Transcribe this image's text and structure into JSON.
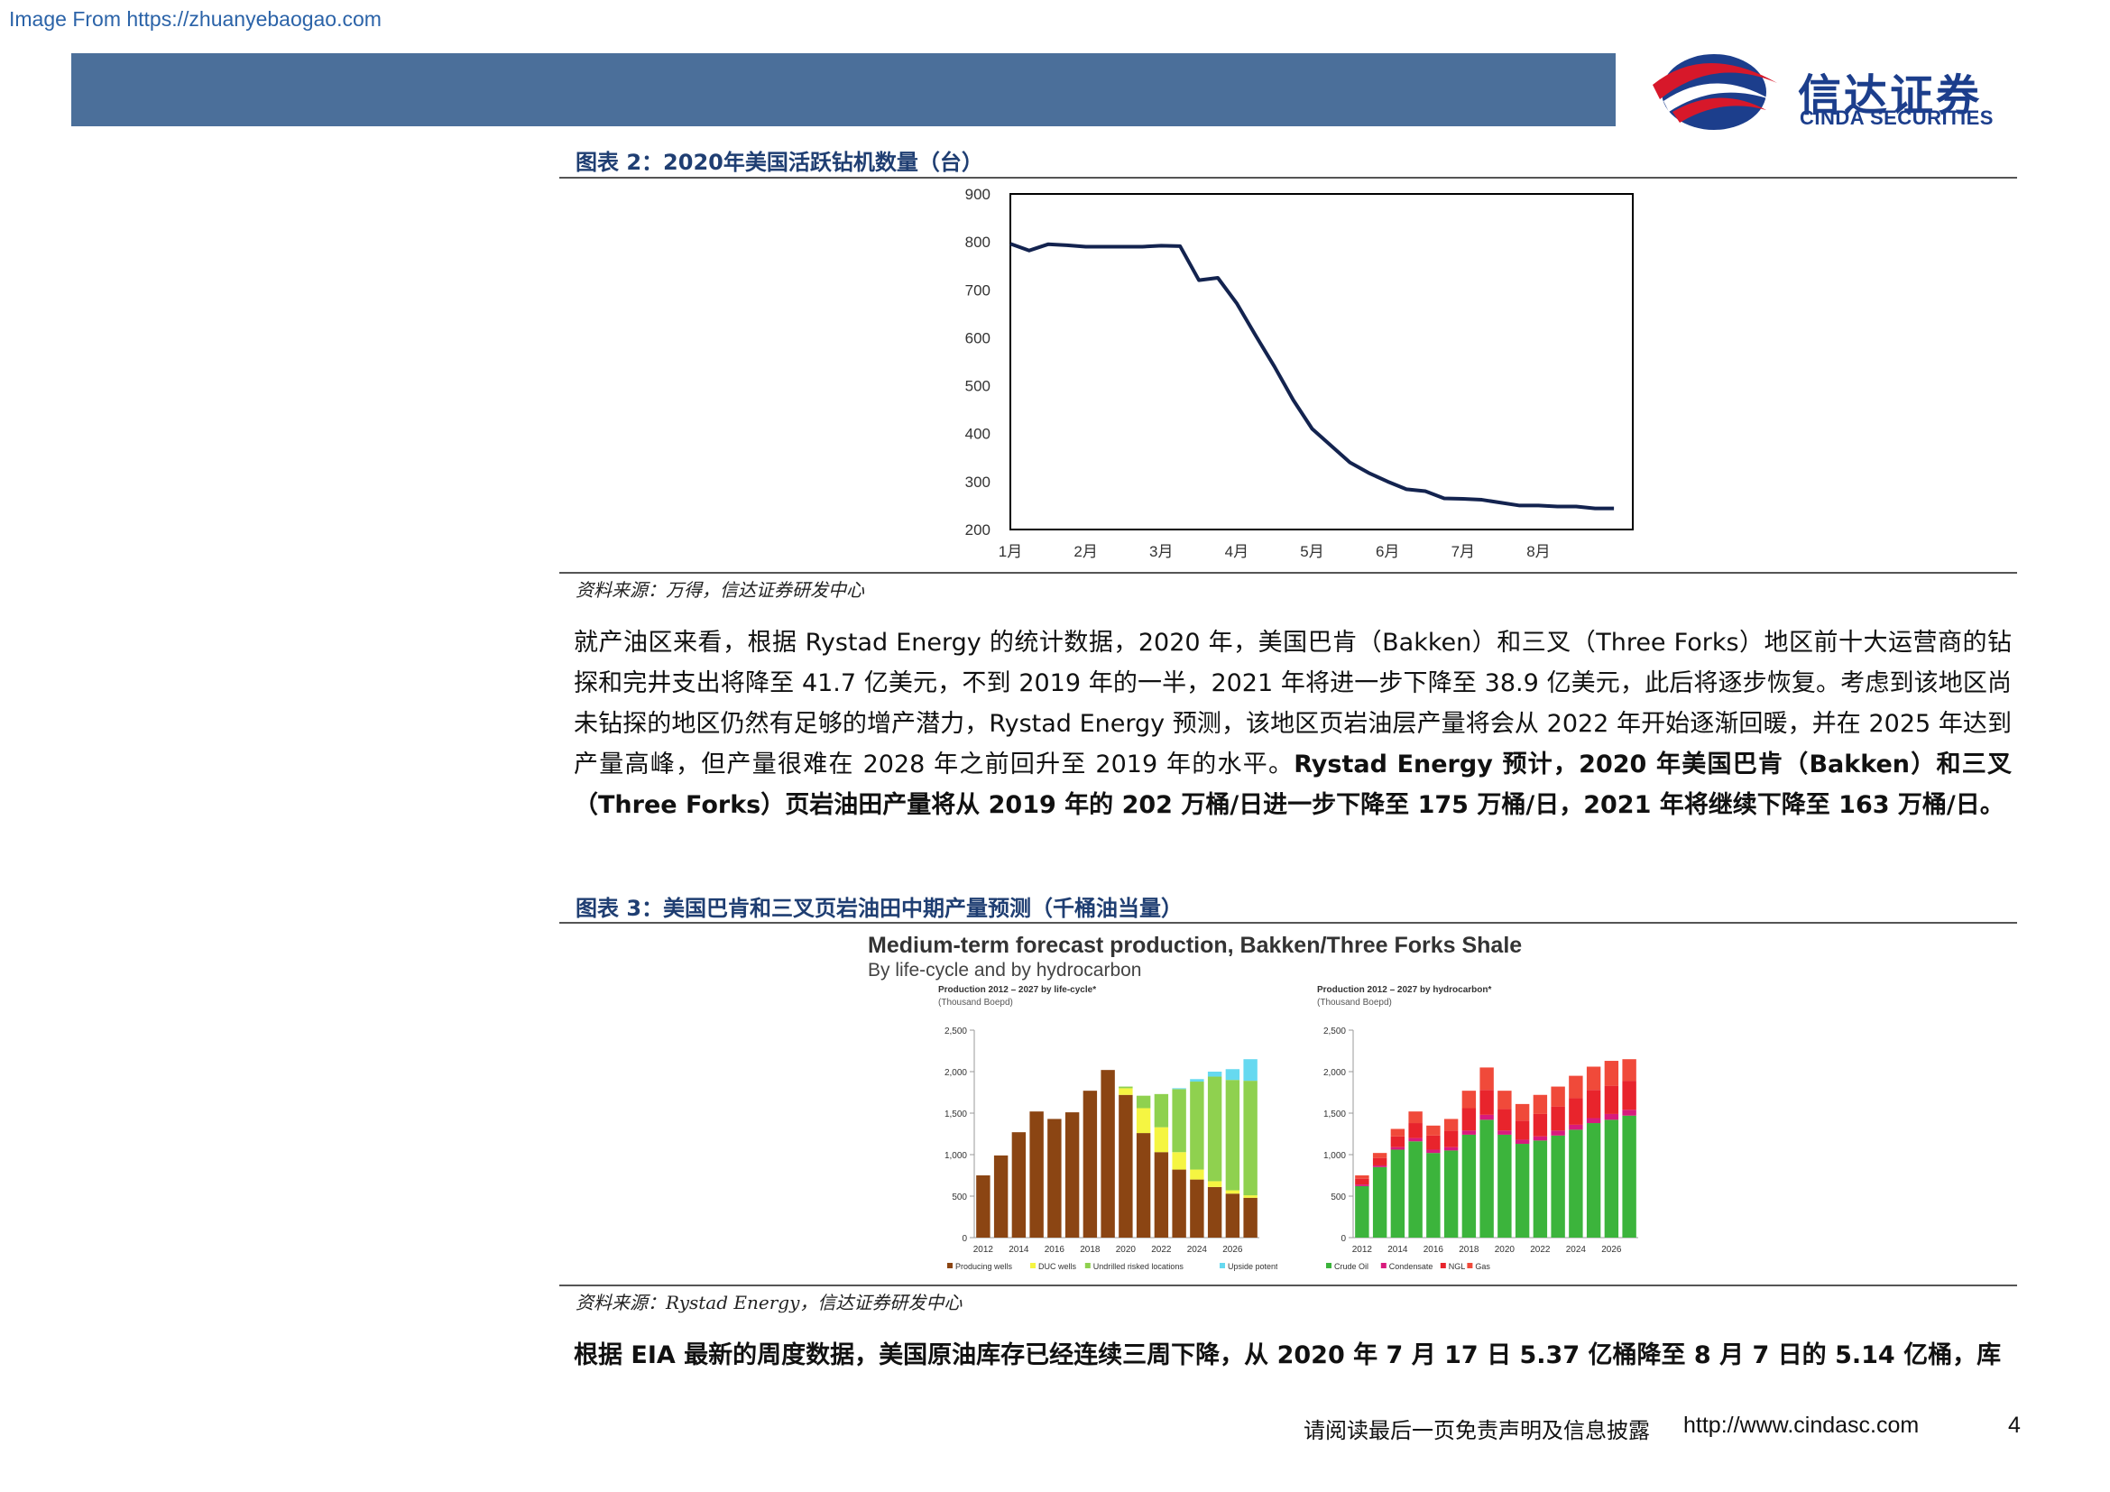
{
  "watermark": "Image From https://zhuanyebaogao.com",
  "logo": {
    "cn": "信达证券",
    "en": "CINDA SECURITIES"
  },
  "figure2": {
    "title": "图表 2：2020年美国活跃钻机数量（台）",
    "source": "资料来源：万得，信达证券研发中心"
  },
  "paragraph1": {
    "text": "就产油区来看，根据 Rystad Energy 的统计数据，2020 年，美国巴肯（Bakken）和三叉（Three Forks）地区前十大运营商的钻探和完井支出将降至 41.7 亿美元，不到 2019 年的一半，2021 年将进一步下降至 38.9 亿美元，此后将逐步恢复。考虑到该地区尚未钻探的地区仍然有足够的增产潜力，Rystad Energy 预测，该地区页岩油层产量将会从 2022 年开始逐渐回暖，并在 2025 年达到产量高峰，但产量很难在 2028 年之前回升至 2019 年的水平。",
    "bold": "Rystad Energy 预计，2020 年美国巴肯（Bakken）和三叉（Three Forks）页岩油田产量将从 2019 年的 202 万桶/日进一步下降至 175 万桶/日，2021 年将继续下降至 163 万桶/日。"
  },
  "figure3": {
    "title": "图表 3：美国巴肯和三叉页岩油田中期产量预测（千桶油当量）",
    "source": "资料来源：Rystad Energy，信达证券研发中心",
    "inner_title": "Medium-term forecast production, Bakken/Three Forks Shale",
    "inner_subtitle": "By life-cycle and by hydrocarbon"
  },
  "paragraph2": {
    "bold": "根据 EIA 最新的周度数据，美国原油库存已经连续三周下降，从 2020 年 7 月 17 日 5.37 亿桶降至 8 月 7 日的 5.14 亿桶，库"
  },
  "footer": {
    "disclaimer": "请阅读最后一页免责声明及信息披露",
    "url": "http://www.cindasc.com",
    "page": "4"
  },
  "colors": {
    "header_bar": "#4b6f9a",
    "brand_blue": "#1c3e8c",
    "brand_red": "#d7182a",
    "line": "#13234f",
    "producing": "#8b4513",
    "duc": "#f5f542",
    "undrilled": "#8fd14f",
    "upside": "#66d9f0",
    "crude": "#3cb43c",
    "condensate": "#d81b7d",
    "ngl": "#e8242c",
    "gas": "#f04a3a"
  },
  "chart_data": [
    {
      "type": "line",
      "x_ticks": [
        "1月",
        "2月",
        "3月",
        "4月",
        "5月",
        "6月",
        "7月",
        "8月"
      ],
      "y_ticks": [
        "900",
        "800",
        "700",
        "600",
        "500",
        "400",
        "300",
        "200"
      ],
      "ylim": [
        200,
        900
      ],
      "x": [
        0,
        0.25,
        0.5,
        0.75,
        1,
        1.25,
        1.5,
        1.75,
        2,
        2.25,
        2.5,
        2.75,
        3,
        3.25,
        3.5,
        3.75,
        4,
        4.25,
        4.5,
        4.75,
        5,
        5.25,
        5.5,
        5.75,
        6,
        6.25,
        6.5,
        6.75,
        7,
        7.25,
        7.5,
        7.75,
        8
      ],
      "values": [
        796,
        782,
        795,
        793,
        790,
        790,
        790,
        790,
        792,
        791,
        720,
        725,
        672,
        605,
        540,
        470,
        410,
        375,
        340,
        318,
        300,
        284,
        280,
        265,
        264,
        262,
        256,
        250,
        250,
        248,
        248,
        244,
        244
      ],
      "series": [
        {
          "values_ref": "values"
        }
      ],
      "grid": false
    },
    {
      "type": "bar",
      "title": "Production 2012 – 2027 by life-cycle*",
      "subtitle": "(Thousand Boepd)",
      "categories": [
        "2012",
        "2013",
        "2014",
        "2015",
        "2016",
        "2017",
        "2018",
        "2019",
        "2020",
        "2021",
        "2022",
        "2023",
        "2024",
        "2025",
        "2026",
        "2027"
      ],
      "x_ticks": [
        "2012",
        "2014",
        "2016",
        "2018",
        "2020",
        "2022",
        "2024",
        "2026"
      ],
      "y_ticks": [
        "2,500",
        "2,000",
        "1,500",
        "1,000",
        "500",
        "0"
      ],
      "ylim": [
        0,
        2500
      ],
      "series": [
        {
          "name": "Producing wells",
          "values": [
            750,
            990,
            1270,
            1520,
            1430,
            1510,
            1770,
            2020,
            1720,
            1260,
            1030,
            820,
            700,
            610,
            530,
            480
          ]
        },
        {
          "name": "DUC wells",
          "values": [
            0,
            0,
            0,
            0,
            0,
            0,
            0,
            0,
            80,
            300,
            300,
            210,
            120,
            70,
            40,
            30
          ]
        },
        {
          "name": "Undrilled risked locations",
          "values": [
            0,
            0,
            0,
            0,
            0,
            0,
            0,
            0,
            20,
            150,
            400,
            760,
            1060,
            1260,
            1330,
            1380
          ]
        },
        {
          "name": "Upside potential",
          "values": [
            0,
            0,
            0,
            0,
            0,
            0,
            0,
            0,
            0,
            0,
            0,
            10,
            30,
            60,
            130,
            260
          ]
        }
      ],
      "legend_position": "bottom"
    },
    {
      "type": "bar",
      "title": "Production 2012 – 2027 by hydrocarbon*",
      "subtitle": "(Thousand Boepd)",
      "categories": [
        "2012",
        "2013",
        "2014",
        "2015",
        "2016",
        "2017",
        "2018",
        "2019",
        "2020",
        "2021",
        "2022",
        "2023",
        "2024",
        "2025",
        "2026",
        "2027"
      ],
      "x_ticks": [
        "2012",
        "2014",
        "2016",
        "2018",
        "2020",
        "2022",
        "2024",
        "2026"
      ],
      "y_ticks": [
        "2,500",
        "2,000",
        "1,500",
        "1,000",
        "500",
        "0"
      ],
      "ylim": [
        0,
        2500
      ],
      "series": [
        {
          "name": "Crude Oil",
          "values": [
            620,
            850,
            1060,
            1160,
            1020,
            1050,
            1240,
            1420,
            1240,
            1130,
            1170,
            1230,
            1300,
            1380,
            1420,
            1470
          ]
        },
        {
          "name": "Condensate",
          "values": [
            20,
            20,
            30,
            40,
            40,
            40,
            50,
            60,
            50,
            50,
            50,
            60,
            60,
            60,
            70,
            70
          ]
        },
        {
          "name": "NGL",
          "values": [
            70,
            90,
            130,
            180,
            170,
            200,
            270,
            300,
            260,
            230,
            270,
            290,
            320,
            340,
            340,
            350
          ]
        },
        {
          "name": "Gas",
          "values": [
            40,
            60,
            90,
            140,
            120,
            140,
            210,
            270,
            220,
            200,
            230,
            240,
            270,
            280,
            300,
            260
          ]
        }
      ],
      "legend_position": "bottom"
    }
  ]
}
